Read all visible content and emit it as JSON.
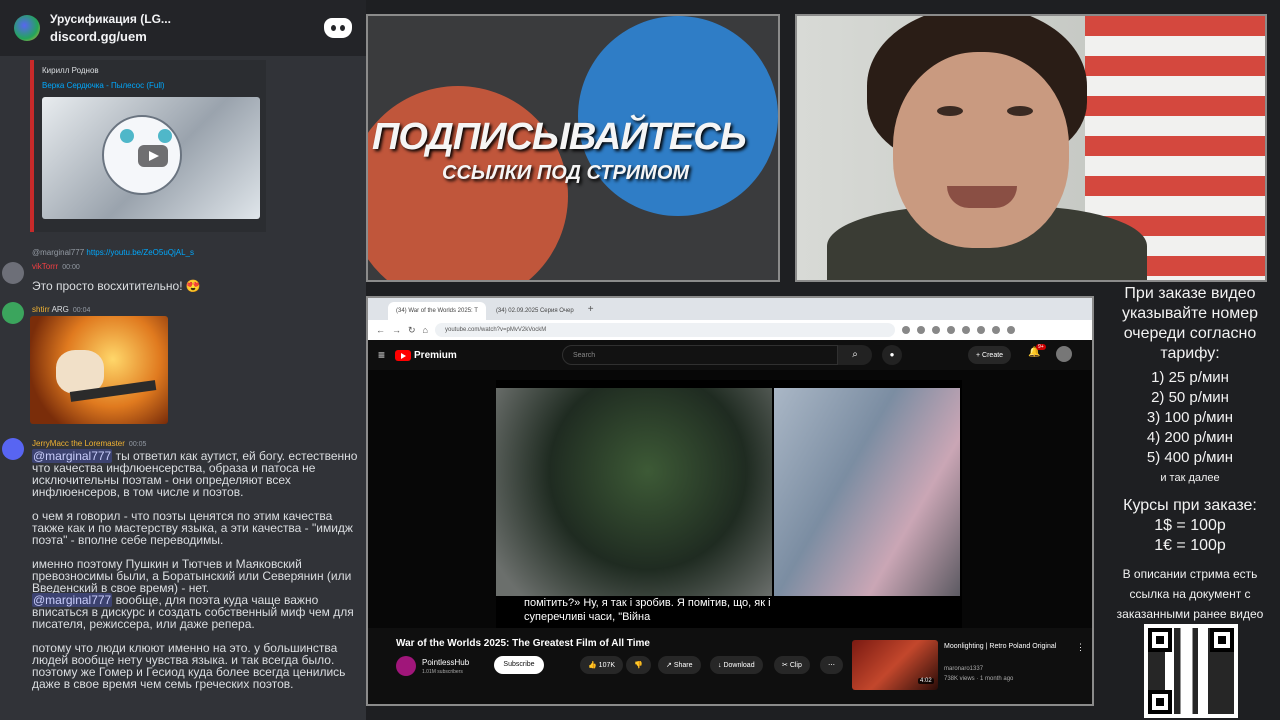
{
  "discord": {
    "server_title": "Урусификация (LG...",
    "invite": "discord.gg/uem",
    "embed": {
      "author": "Кирилл Роднов",
      "link": "Верка Сердючка - Пылесос (Full)"
    },
    "reply": {
      "user": "@marginal777",
      "link": "https://youtu.be/ZeO5uQjAL_s"
    },
    "messages": [
      {
        "name": "vikTorrr",
        "time": "00:00",
        "color": "#f23f43",
        "text": "Это просто восхитительно!"
      },
      {
        "name": "shtirr",
        "badge": "ARG",
        "time": "00:04",
        "color": "#f0b232"
      },
      {
        "name": "JerryMacc the Loremaster",
        "time": "00:05",
        "color": "#f0b232"
      }
    ],
    "long_message": {
      "p1_mention": "@marginal777",
      "p1": " ты ответил как аутист, ей богу. естественно что качества  инфлюенсерства, образа и патоса не исключительны поэтам - они определяют всех инфлюенсеров, в том числе и поэтов.",
      "p2": "о чем я говорил - что поэты ценятся по этим качества также как и по мастерству языка, а эти качества - \"имидж поэта\" - вполне себе переводимы.",
      "p3": "именно поэтому Пушкин и Тютчев и Маяковский превозносимы были, а Боратынский или Северянин (или Введенский в свое время) - нет.",
      "p4_mention": "@marginal777",
      "p4": " вообще, для поэта куда чаще важно вписаться в дискурс и создать собственный миф чем для писателя, режиссера, или даже репера.",
      "p5": "потому что люди клюют именно на это. у большинства людей вообще нету чувства языка. и так всегда было. поэтому же Гомер и Гесиод куда более всегда ценились даже в свое время чем семь греческих поэтов."
    }
  },
  "promo": {
    "headline": "ПОДПИСЫВАЙТЕСЬ",
    "subline": "ССЫЛКИ ПОД СТРИМОМ"
  },
  "browser": {
    "tabs": [
      "(34) War of the Worlds 2025: T",
      "(34) 02.09.2025 Серия Очер"
    ],
    "url": "youtube.com/watch?v=pMvV2kVockM",
    "yt": {
      "brand": "Premium",
      "search_placeholder": "Search",
      "create": "Create",
      "notif": "9+",
      "subtitle": "помітить?»  Ну, я так і зробив.  Я помітив, що, як і суперечливі часи, \"Війна",
      "title": "War of the Worlds 2025: The Greatest Film of All Time",
      "channel": "PointlessHub",
      "subs": "1.01M subscribers",
      "subscribe": "Subscribe",
      "likes": "107K",
      "share": "Share",
      "download": "Download",
      "clip": "Clip",
      "rec": {
        "title": "Moonlighting | Retro Poland Original",
        "channel": "maronaro1337",
        "meta": "738K views · 1 month ago",
        "duration": "4:02"
      }
    }
  },
  "info": {
    "line1": "При заказе видео указывайте номер очереди согласно тарифу:",
    "tariffs": [
      "1) 25 р/мин",
      "2) 50 р/мин",
      "3) 100 р/мин",
      "4) 200 р/мин",
      "5) 400 р/мин"
    ],
    "etc": "и так далее",
    "courses_title": "Курсы при заказе:",
    "usd": "1$ = 100р",
    "eur": "1€ = 100р",
    "note": "В описании стрима есть ссылка на документ с заказанными ранее видео"
  }
}
